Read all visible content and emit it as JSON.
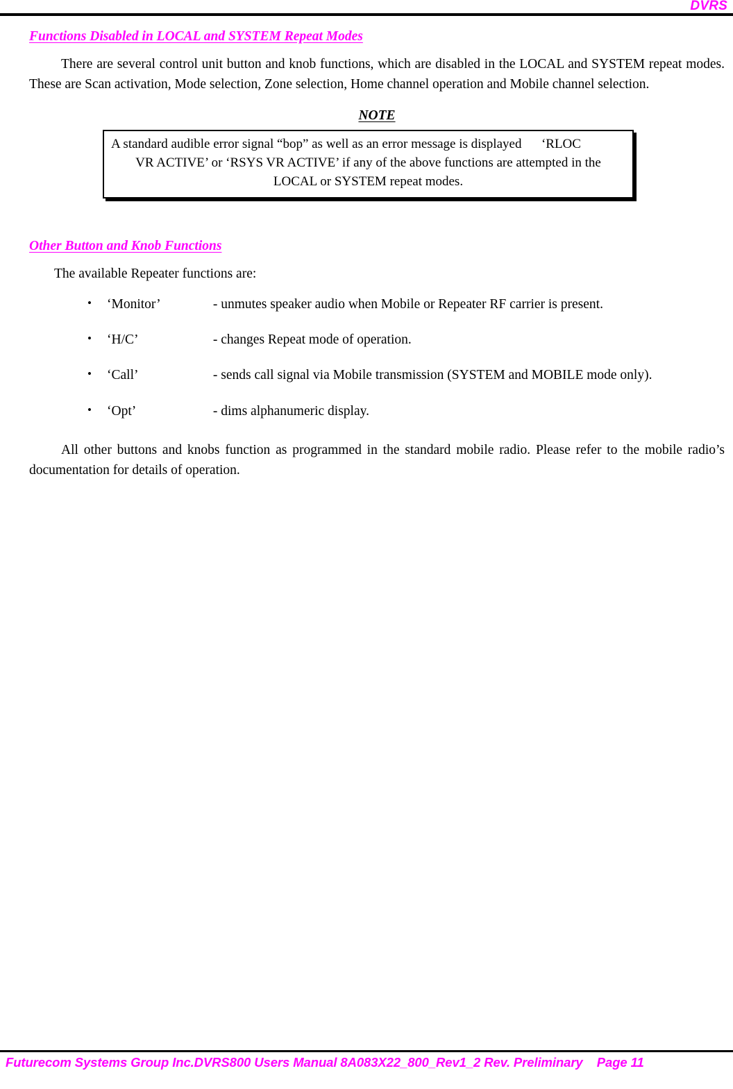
{
  "header": {
    "title": "DVRS"
  },
  "sections": {
    "disabled_functions": {
      "heading": "Functions Disabled in LOCAL and SYSTEM Repeat Modes",
      "paragraph": "There are several control unit button and knob functions, which are disabled in the LOCAL and SYSTEM repeat modes.  These are Scan activation, Mode selection, Zone selection, Home channel operation and Mobile channel selection."
    },
    "note": {
      "title": "NOTE",
      "line1": "A standard audible error signal “bop” as well as an error message is displayed      ‘RLOC",
      "line2": "VR ACTIVE’ or ‘RSYS VR ACTIVE’ if any of the above functions are attempted in the",
      "line3": "LOCAL or SYSTEM repeat modes."
    },
    "other_functions": {
      "heading": "Other Button and Knob Functions",
      "intro": "The available Repeater functions are:",
      "bullet_char": "•",
      "items": [
        {
          "name": "‘Monitor’",
          "description": "- unmutes speaker audio when Mobile or Repeater RF carrier is present."
        },
        {
          "name": "‘H/C’",
          "description": "- changes Repeat mode of operation."
        },
        {
          "name": "‘Call’",
          "description": "- sends call signal via Mobile transmission (SYSTEM and MOBILE mode only)."
        },
        {
          "name": "‘Opt’",
          "description": "- dims alphanumeric display."
        }
      ],
      "closing_paragraph": "All other buttons and knobs function as programmed in the standard mobile radio. Please refer to the mobile radio’s documentation for details of operation."
    }
  },
  "footer": {
    "text": "Futurecom Systems Group Inc.DVRS800 Users Manual 8A083X22_800_Rev1_2 Rev. Preliminary    Page 11"
  },
  "colors": {
    "accent": "#FF00FF",
    "text": "#000000",
    "background": "#FFFFFF"
  }
}
